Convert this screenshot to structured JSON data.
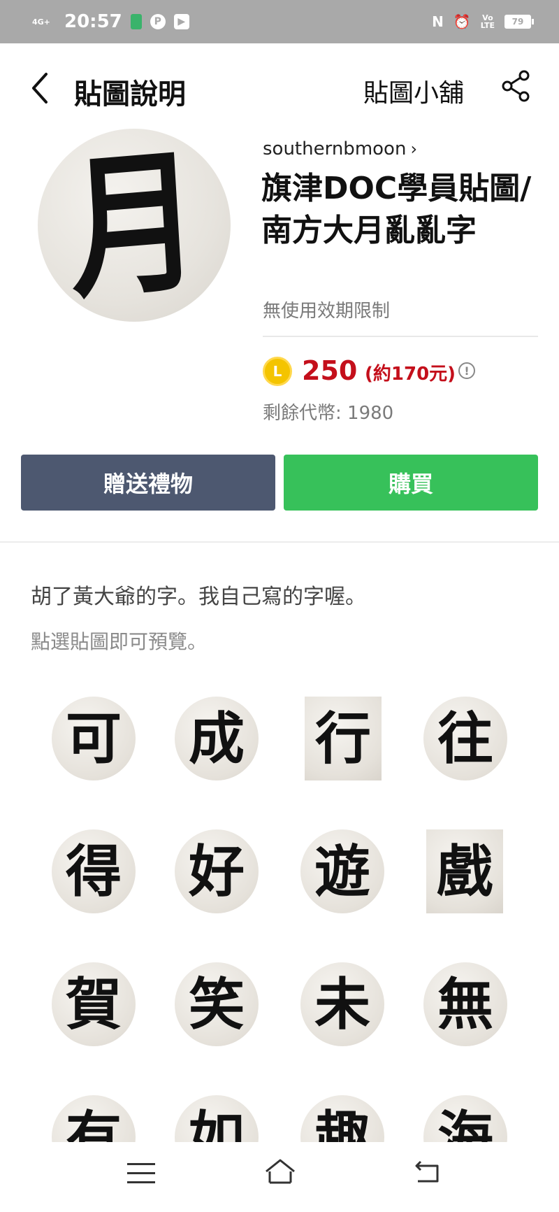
{
  "status_bar": {
    "network": "4G+",
    "time": "20:57",
    "volte": "Vo\nLTE",
    "battery": "79"
  },
  "header": {
    "title": "貼圖說明",
    "shop_link": "貼圖小舖"
  },
  "product": {
    "cover_char": "月",
    "author": "southernbmoon",
    "title": "旗津DOC學員貼圖/南方大月亂亂字",
    "validity": "無使用效期限制",
    "coin_symbol": "L",
    "price": "250",
    "price_approx": "(約170元)",
    "remaining": "剩餘代幣: 1980"
  },
  "actions": {
    "gift_label": "贈送禮物",
    "buy_label": "購買"
  },
  "description": "胡了黃大爺的字。我自己寫的字喔。",
  "preview_hint": "點選貼圖即可預覽。",
  "stickers": [
    "可",
    "成",
    "行",
    "往",
    "得",
    "好",
    "遊",
    "戲",
    "賀",
    "笑",
    "未",
    "無",
    "有",
    "如",
    "趣",
    "海"
  ],
  "colors": {
    "price_red": "#c40f1b",
    "gift_button": "#4d5870",
    "buy_button": "#37c15a",
    "status_bar": "#a9a9a9"
  }
}
